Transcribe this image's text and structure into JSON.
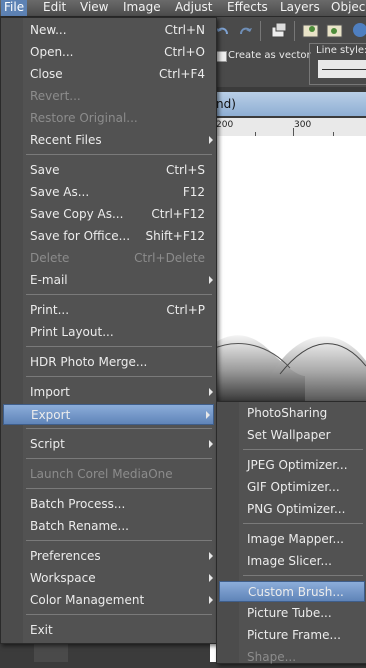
{
  "menubar": {
    "items": [
      {
        "label": "File",
        "selected": true
      },
      {
        "label": "Edit"
      },
      {
        "label": "View"
      },
      {
        "label": "Image"
      },
      {
        "label": "Adjust"
      },
      {
        "label": "Effects"
      },
      {
        "label": "Layers"
      },
      {
        "label": "Objec"
      }
    ]
  },
  "toolbar": {
    "create_as_vector_label": "Create as vector",
    "line_style_label": "Line style:"
  },
  "document": {
    "title_fragment": "nd)",
    "ruler_labels": [
      "200",
      "300"
    ]
  },
  "file_menu": {
    "items": [
      {
        "label": "New...",
        "shortcut": "Ctrl+N"
      },
      {
        "label": "Open...",
        "shortcut": "Ctrl+O"
      },
      {
        "label": "Close",
        "shortcut": "Ctrl+F4"
      },
      {
        "label": "Revert...",
        "disabled": true
      },
      {
        "label": "Restore Original...",
        "disabled": true
      },
      {
        "label": "Recent Files",
        "submenu": true
      },
      {
        "label": "Save",
        "shortcut": "Ctrl+S"
      },
      {
        "label": "Save As...",
        "shortcut": "F12"
      },
      {
        "label": "Save Copy As...",
        "shortcut": "Ctrl+F12"
      },
      {
        "label": "Save for Office...",
        "shortcut": "Shift+F12"
      },
      {
        "label": "Delete",
        "shortcut": "Ctrl+Delete",
        "disabled": true
      },
      {
        "label": "E-mail",
        "submenu": true
      },
      {
        "label": "Print...",
        "shortcut": "Ctrl+P"
      },
      {
        "label": "Print Layout..."
      },
      {
        "label": "HDR Photo Merge..."
      },
      {
        "label": "Import",
        "submenu": true
      },
      {
        "label": "Export",
        "submenu": true,
        "highlighted": true
      },
      {
        "label": "Script",
        "submenu": true
      },
      {
        "label": "Launch Corel MediaOne",
        "disabled": true
      },
      {
        "label": "Batch Process..."
      },
      {
        "label": "Batch Rename..."
      },
      {
        "label": "Preferences",
        "submenu": true
      },
      {
        "label": "Workspace",
        "submenu": true
      },
      {
        "label": "Color Management",
        "submenu": true
      },
      {
        "label": "Exit"
      }
    ]
  },
  "export_menu": {
    "items": [
      {
        "label": "PhotoSharing"
      },
      {
        "label": "Set Wallpaper"
      },
      {
        "label": "JPEG Optimizer..."
      },
      {
        "label": "GIF Optimizer..."
      },
      {
        "label": "PNG Optimizer..."
      },
      {
        "label": "Image Mapper..."
      },
      {
        "label": "Image Slicer..."
      },
      {
        "label": "Custom Brush...",
        "highlighted": true
      },
      {
        "label": "Picture Tube..."
      },
      {
        "label": "Picture Frame..."
      },
      {
        "label": "Shape...",
        "disabled": true
      }
    ]
  },
  "colors": {
    "menu_bg": "#525252",
    "highlight": "#6f93c6",
    "disabled_text": "#8c8c8c",
    "title_bar": "#a7c1e0"
  }
}
